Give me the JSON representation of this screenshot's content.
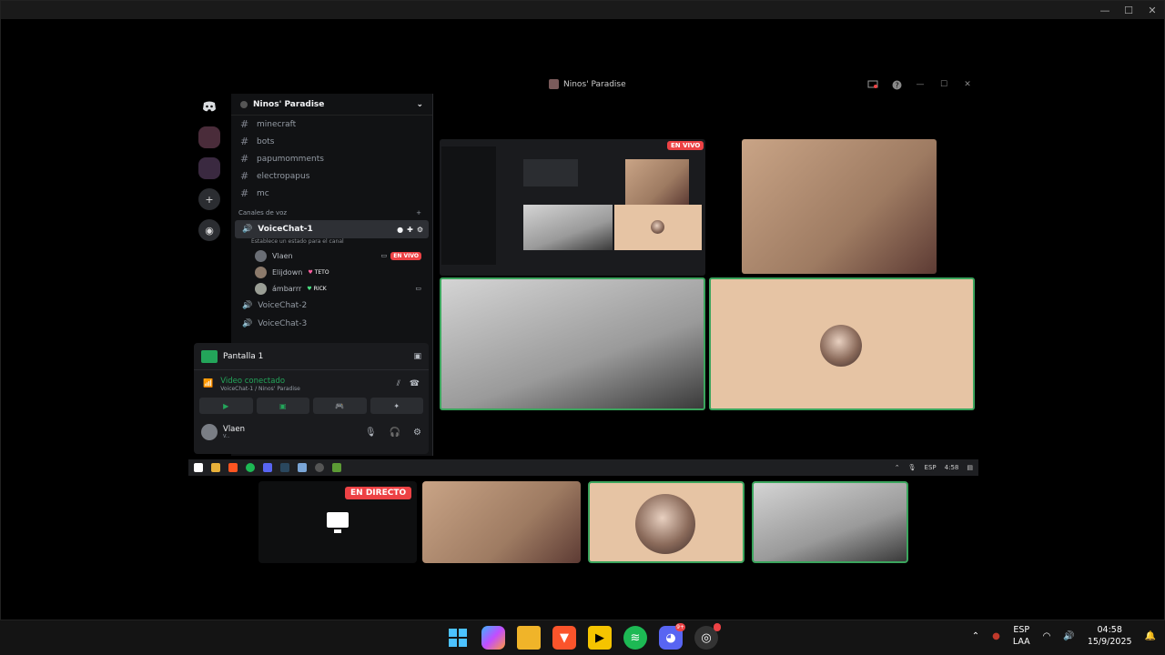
{
  "outer_window": {
    "controls": [
      "—",
      "☐",
      "✕"
    ]
  },
  "stream": {
    "title": "Ninos' Paradise",
    "controls": [
      "screen-icon",
      "help-icon",
      "—",
      "☐",
      "✕"
    ]
  },
  "guild": {
    "name": "Ninos' Paradise",
    "text_channels": [
      "minecraft",
      "bots",
      "papumomments",
      "electropapus",
      "mc"
    ],
    "voice_category": "Canales de voz",
    "voice_channels": [
      {
        "name": "VoiceChat-1",
        "status": "Establece un estado para el canal",
        "active": true
      },
      {
        "name": "VoiceChat-2"
      },
      {
        "name": "VoiceChat-3"
      }
    ],
    "members": [
      {
        "name": "Vlaen",
        "badge": "EN VIVO"
      },
      {
        "name": "Elijdown",
        "badge": "TETO"
      },
      {
        "name": "ámbarrr",
        "badge": "RICK"
      }
    ]
  },
  "panel": {
    "screen_label": "Pantalla 1",
    "connected_label": "Video conectado",
    "connected_sub": "VoiceChat-1 / Ninos' Paradise",
    "user_name": "Vlaen",
    "user_status": "V..."
  },
  "badges": {
    "en_vivo": "EN VIVO",
    "en_directo": "EN DIRECTO"
  },
  "inner_taskbar": {
    "lang": "ESP",
    "time": "4:58"
  },
  "taskbar": {
    "lang1": "ESP",
    "lang2": "LAA",
    "time": "04:58",
    "date": "15/9/2025",
    "discord_badge": "9+"
  },
  "colors": {
    "accent_green": "#3ba55d",
    "live_red": "#ed4245",
    "discord_bg": "#111214"
  }
}
